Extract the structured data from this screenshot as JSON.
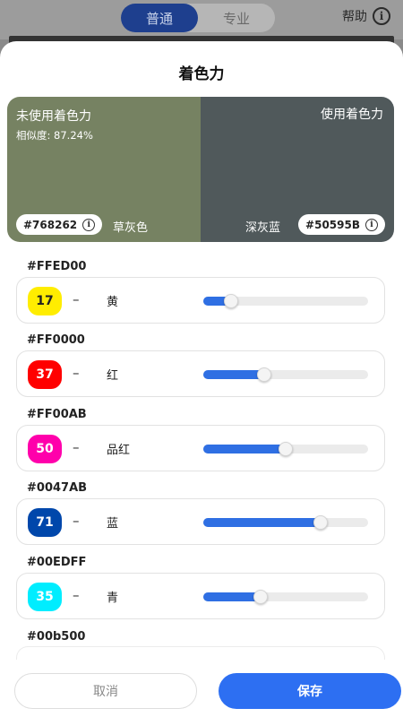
{
  "header": {
    "tabs": [
      {
        "label": "普通",
        "active": true
      },
      {
        "label": "专业",
        "active": false
      }
    ],
    "help_label": "帮助",
    "help_icon": "info-icon"
  },
  "sheet": {
    "title": "着色力",
    "compare": {
      "left_label": "未使用着色力",
      "similarity": "相似度: 87.24%",
      "left_hex": "#768262",
      "left_name": "草灰色",
      "left_color": "#768262",
      "right_label": "使用着色力",
      "right_hex": "#50595B",
      "right_name": "深灰蓝",
      "right_color": "#50595B"
    },
    "inks": [
      {
        "hex": "#FFED00",
        "value": "17",
        "dash": "–",
        "name": "黄",
        "color": "#FFED00",
        "text_color": "#222222",
        "level_fraction": 0.17
      },
      {
        "hex": "#FF0000",
        "value": "37",
        "dash": "–",
        "name": "红",
        "color": "#FF0000",
        "text_color": "#ffffff",
        "level_fraction": 0.37
      },
      {
        "hex": "#FF00AB",
        "value": "50",
        "dash": "–",
        "name": "品红",
        "color": "#FF00AB",
        "text_color": "#ffffff",
        "level_fraction": 0.5
      },
      {
        "hex": "#0047AB",
        "value": "71",
        "dash": "–",
        "name": "蓝",
        "color": "#0047AB",
        "text_color": "#ffffff",
        "level_fraction": 0.71
      },
      {
        "hex": "#00EDFF",
        "value": "35",
        "dash": "–",
        "name": "青",
        "color": "#00EDFF",
        "text_color": "#ffffff",
        "level_fraction": 0.35
      }
    ],
    "partial_ink_hex": "#00b500",
    "cancel_label": "取消",
    "save_label": "保存"
  },
  "colors": {
    "accent": "#2d6ff2"
  }
}
